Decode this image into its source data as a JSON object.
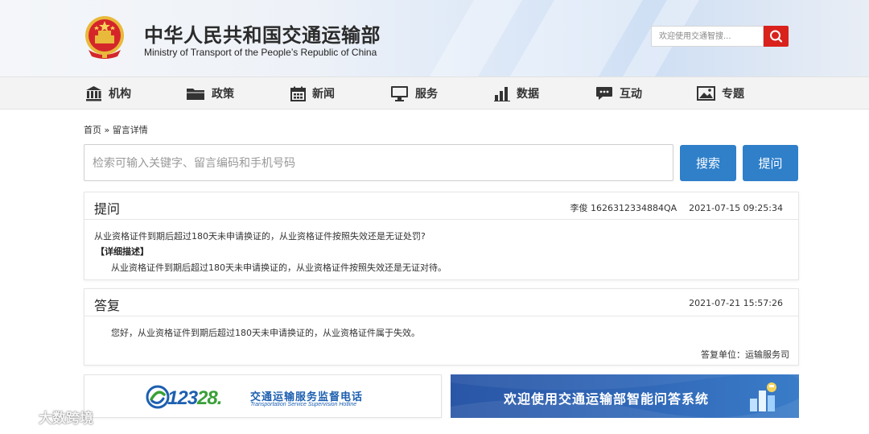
{
  "header": {
    "title_cn": "中华人民共和国交通运输部",
    "title_en": "Ministry of Transport of the People’s Republic of China",
    "search_placeholder": "欢迎使用交通智搜...",
    "search_icon": "magnifier-icon"
  },
  "nav": {
    "items": [
      {
        "label": "机构",
        "icon": "building-icon"
      },
      {
        "label": "政策",
        "icon": "folder-icon"
      },
      {
        "label": "新闻",
        "icon": "calendar-icon"
      },
      {
        "label": "服务",
        "icon": "monitor-icon"
      },
      {
        "label": "数据",
        "icon": "bar-chart-icon"
      },
      {
        "label": "互动",
        "icon": "chat-bubble-icon"
      },
      {
        "label": "专题",
        "icon": "picture-icon"
      }
    ]
  },
  "breadcrumb": {
    "home": "首页",
    "separator": "»",
    "current": "留言详情"
  },
  "search": {
    "placeholder": "检索可输入关键字、留言编码和手机号码",
    "search_button": "搜索",
    "ask_button": "提问"
  },
  "question": {
    "heading": "提问",
    "author_id": "李俊 1626312334884QA",
    "datetime": "2021-07-15 09:25:34",
    "title": "从业资格证件到期后超过180天未申请换证的，从业资格证件按照失效还是无证处罚?",
    "detail_label": "【详细描述】",
    "detail_text": "从业资格证件到期后超过180天未申请换证的，从业资格证件按照失效还是无证对待。"
  },
  "answer": {
    "heading": "答复",
    "datetime": "2021-07-21 15:57:26",
    "text": "您好，从业资格证件到期后超过180天未申请换证的，从业资格证件属于失效。",
    "unit": "答复单位：运输服务司"
  },
  "banners": {
    "hotline_number_a": "123",
    "hotline_number_b": "28.",
    "hotline_cn": "交通运输服务监督电话",
    "hotline_en": "Transportation Service Supervision Hotline",
    "assistant_text": "欢迎使用交通运输部智能问答系统"
  },
  "watermark": "大数跨境",
  "colors": {
    "brand_red": "#d9221c",
    "button_blue": "#2f7fc9",
    "banner_blue": "#2a56a6"
  }
}
